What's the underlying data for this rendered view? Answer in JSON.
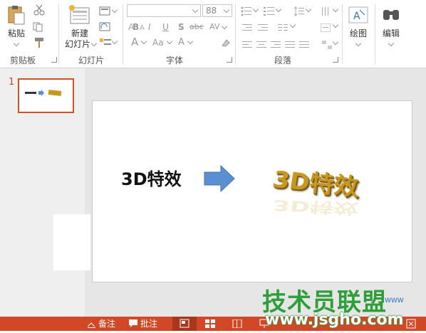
{
  "ribbon": {
    "clipboard": {
      "paste_label": "粘贴",
      "group_label": "剪贴板"
    },
    "slides": {
      "new_slide_label_1": "新建",
      "new_slide_label_2": "幻灯片",
      "group_label": "幻灯片"
    },
    "font": {
      "size_value": "88",
      "bold": "B",
      "italic": "I",
      "underline": "U",
      "shadow": "S",
      "strike": "abc",
      "spacing": "AV",
      "font_color": "A",
      "change_case": "Aa",
      "grow": "A",
      "group_label": "字体"
    },
    "paragraph": {
      "group_label": "段落"
    },
    "drawing": {
      "label": "绘图"
    },
    "editing": {
      "label": "编辑"
    }
  },
  "slides_pane": {
    "slide_number": "1"
  },
  "slide": {
    "plain_text": "3D特效",
    "styled_text": "3D特效"
  },
  "statusbar": {
    "notes_label": "备注",
    "comments_label": "批注"
  },
  "watermark": {
    "text": "技术员联盟",
    "url": "www.jsgho.com",
    "small": "WWW"
  },
  "colors": {
    "accent": "#d24726",
    "thumb_border": "#d0522a",
    "arrow": "#5b8fd1",
    "watermark": "#2e9e3a"
  }
}
